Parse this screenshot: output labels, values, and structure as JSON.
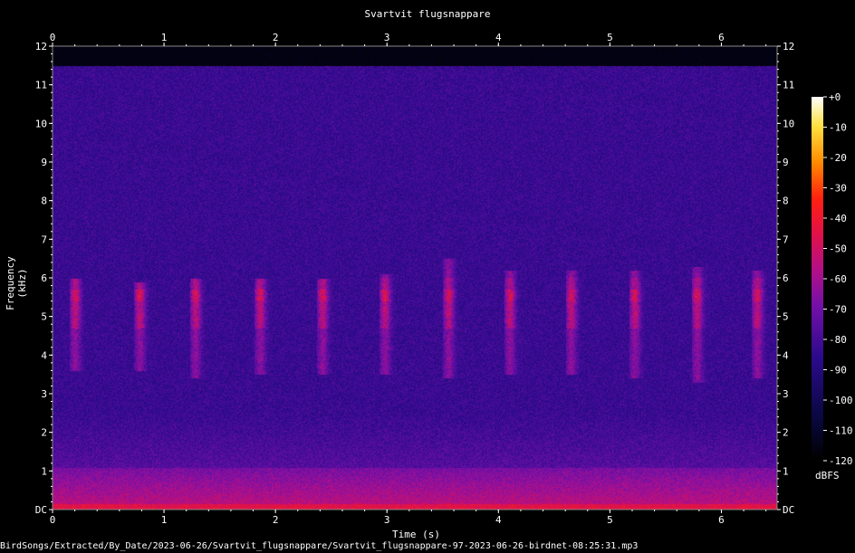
{
  "title": "Svartvit flugsnappare",
  "footer": "BirdSongs/Extracted/By_Date/2023-06-26/Svartvit_flugsnappare/Svartvit_flugsnappare-97-2023-06-26-birdnet-08:25:31.mp3",
  "chart_data": {
    "type": "heatmap",
    "title": "Svartvit flugsnappare",
    "xlabel": "Time (s)",
    "ylabel": "Frequency (kHz)",
    "xlim": [
      0,
      6.5
    ],
    "ylim": [
      0,
      12
    ],
    "xticks": [
      "0",
      "1",
      "2",
      "3",
      "4",
      "5",
      "6"
    ],
    "yticks": [
      "DC",
      "1",
      "2",
      "3",
      "4",
      "5",
      "6",
      "7",
      "8",
      "9",
      "10",
      "11",
      "12"
    ],
    "colorbar": {
      "label": "dBFS",
      "ticks": [
        "+0",
        "-10",
        "-20",
        "-30",
        "-40",
        "-50",
        "-60",
        "-70",
        "-80",
        "-90",
        "-100",
        "-110",
        "-120"
      ],
      "range": [
        -120,
        0
      ]
    },
    "calls": [
      {
        "t": 0.2,
        "fmin": 3.6,
        "fmax": 6.0
      },
      {
        "t": 0.78,
        "fmin": 3.6,
        "fmax": 5.9
      },
      {
        "t": 1.28,
        "fmin": 3.4,
        "fmax": 6.0
      },
      {
        "t": 1.86,
        "fmin": 3.5,
        "fmax": 6.0
      },
      {
        "t": 2.42,
        "fmin": 3.5,
        "fmax": 6.0
      },
      {
        "t": 2.98,
        "fmin": 3.5,
        "fmax": 6.1
      },
      {
        "t": 3.55,
        "fmin": 3.4,
        "fmax": 6.5
      },
      {
        "t": 4.1,
        "fmin": 3.5,
        "fmax": 6.2
      },
      {
        "t": 4.65,
        "fmin": 3.5,
        "fmax": 6.2
      },
      {
        "t": 5.22,
        "fmin": 3.4,
        "fmax": 6.2
      },
      {
        "t": 5.78,
        "fmin": 3.3,
        "fmax": 6.3
      },
      {
        "t": 6.32,
        "fmin": 3.4,
        "fmax": 6.2
      }
    ]
  }
}
